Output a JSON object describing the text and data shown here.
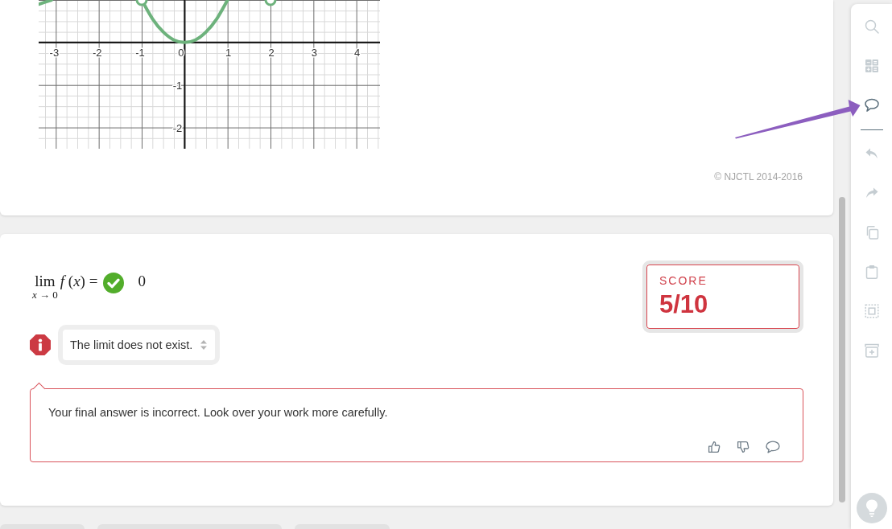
{
  "question": {
    "graph": {
      "chart_data": {
        "type": "line",
        "xlim": [
          -3.4,
          4.55
        ],
        "ylim": [
          -2.5,
          1
        ],
        "xticks": [
          -3,
          -2,
          -1,
          0,
          1,
          2,
          3,
          4
        ],
        "yticks": [
          -2,
          -1
        ],
        "grid": true,
        "series": [
          {
            "color": "#6db27c",
            "x": [
              -3.4,
              -3.1
            ],
            "values": [
              0.9,
              1
            ]
          },
          {
            "color": "#6db27c",
            "x": [
              -1,
              -0.75,
              -0.5,
              -0.25,
              0,
              0.25,
              0.5,
              0.75,
              1
            ],
            "values": [
              1,
              0.56,
              0.25,
              0.06,
              0,
              0.06,
              0.25,
              0.56,
              1
            ]
          },
          {
            "type": "scatter",
            "marker": "open-circle",
            "color": "#6db27c",
            "x": [
              -1,
              2
            ],
            "values": [
              1,
              1
            ]
          }
        ]
      }
    },
    "copyright": "© NJCTL 2014-2016"
  },
  "answer_card": {
    "limit": {
      "operator": "lim",
      "subscript": "*x* → 0",
      "expression": "*f* (*x*) =",
      "answer": {
        "value": "0",
        "correct": true
      }
    },
    "response": {
      "value": "The limit does not exist.",
      "correct": false
    },
    "score": {
      "label": "SCORE",
      "value": "5/10"
    },
    "feedback": {
      "text": "Your final answer is incorrect. Look over your work more carefully."
    }
  },
  "toolbar": {
    "items": [
      {
        "kind": "search",
        "active": false
      },
      {
        "kind": "calculator",
        "active": false
      },
      {
        "kind": "comment",
        "active": true
      },
      {
        "kind": "divider"
      },
      {
        "kind": "undo",
        "active": false
      },
      {
        "kind": "redo",
        "active": false
      },
      {
        "kind": "copy",
        "active": false
      },
      {
        "kind": "paste",
        "active": false
      },
      {
        "kind": "select",
        "active": false
      },
      {
        "kind": "add",
        "active": false
      }
    ]
  }
}
